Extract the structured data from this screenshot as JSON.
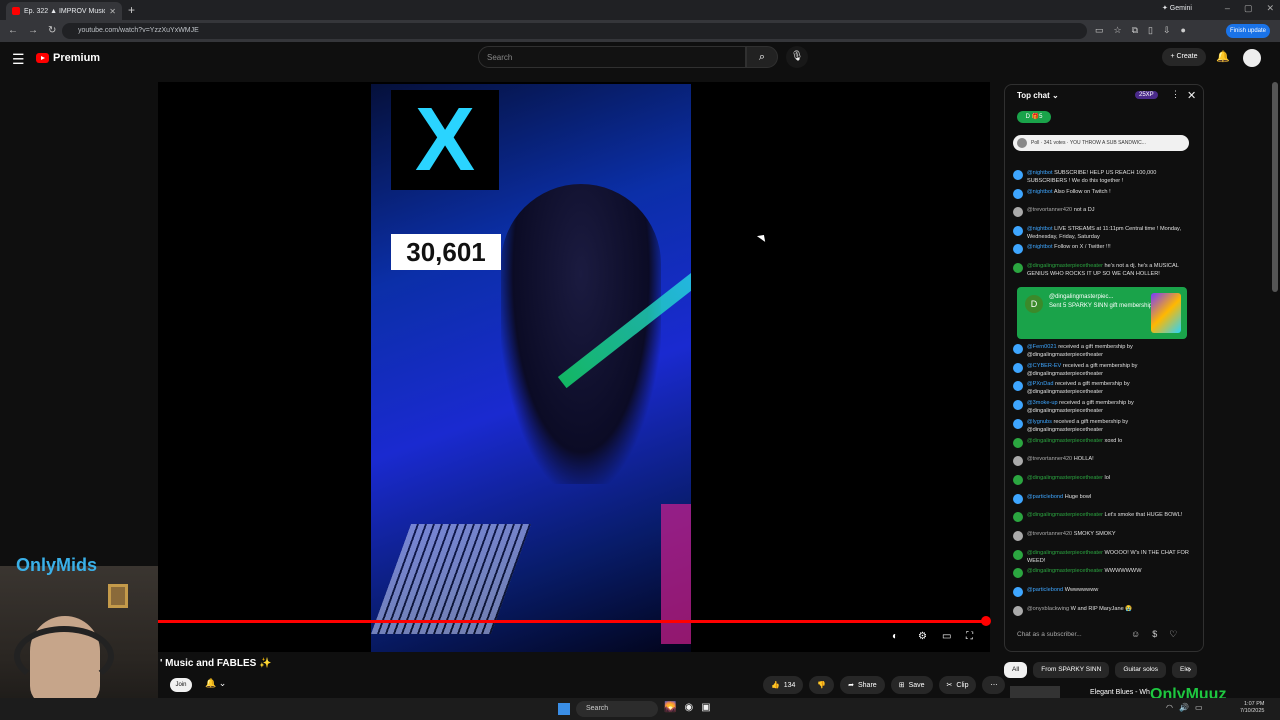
{
  "browser": {
    "tab_title": "Ep. 322 ▲ IMPROV Music",
    "tab_close": "✕",
    "new_tab": "+",
    "gemini_label": "✦ Gemini",
    "address": "youtube.com/watch?v=YzzXuYxWMJE",
    "finish_update": "Finish update",
    "nav_back": "←",
    "nav_forward": "→",
    "nav_reload": "↻"
  },
  "youtube": {
    "logo_text": "Premium",
    "search_placeholder": "Search",
    "create_label": "+ Create"
  },
  "video": {
    "sign_number": "30,601",
    "progress_fraction": 0.995,
    "title": "' Music and FABLES ✨",
    "join_label": "Join",
    "likes": "134",
    "share_label": "Share",
    "save_label": "Save",
    "clip_label": "Clip",
    "more_label": "⋯"
  },
  "webcam": {
    "overlay_logo": "OnlyMids"
  },
  "chat": {
    "header_label": "Top chat ⌄",
    "xp_badge": "25XP",
    "donor_pill": "D 🎁5",
    "poll_text": "Poll · 341 votes · YOU THROW A SUB SANDWIC...",
    "messages": [
      {
        "user": "@nightbot",
        "text": "SUBSCRIBE! HELP US REACH 100,000 SUBSCRIBERS ! We do this together !",
        "color": "#3ea6ff"
      },
      {
        "user": "@nightbot",
        "text": "Also Follow on Twitch !",
        "color": "#3ea6ff"
      },
      {
        "user": "@trevortanner420",
        "text": "not a DJ",
        "color": "#aaaaaa"
      },
      {
        "user": "@nightbot",
        "text": "LIVE STREAMS at 11:11pm Central time ! Monday, Wednesday, Friday, Saturday",
        "color": "#3ea6ff"
      },
      {
        "user": "@nightbot",
        "text": "Follow on X / Twitter !!!",
        "color": "#3ea6ff"
      },
      {
        "user": "@dingalingmasterpiecetheater",
        "text": "he's not a dj. he's a MUSICAL GENIUS WHO ROCKS IT UP SO WE CAN HOLLER!",
        "color": "#2ba640"
      }
    ],
    "gift": {
      "user": "@dingalingmasterpiec...",
      "text": "Sent 5 SPARKY SINN gift memberships",
      "initial": "D"
    },
    "messages2": [
      {
        "user": "@Fern0021",
        "text": "received a gift membership by @dingalingmasterpiecetheater",
        "color": "#3ea6ff"
      },
      {
        "user": "@CYBER-EV",
        "text": "received a gift membership by @dingalingmasterpiecetheater",
        "color": "#3ea6ff"
      },
      {
        "user": "@PXnDad",
        "text": "received a gift membership by @dingalingmasterpiecetheater",
        "color": "#3ea6ff"
      },
      {
        "user": "@3moke-up",
        "text": "received a gift membership by @dingalingmasterpiecetheater",
        "color": "#3ea6ff"
      },
      {
        "user": "@lygnubs",
        "text": "received a gift membership by @dingalingmasterpiecetheater",
        "color": "#3ea6ff"
      },
      {
        "user": "@dingalingmasterpiecetheater",
        "text": "xoxd lo",
        "color": "#2ba640"
      },
      {
        "user": "@trevortanner420",
        "text": "HOLLA!",
        "color": "#aaaaaa"
      },
      {
        "user": "@dingalingmasterpiecetheater",
        "text": "lol",
        "color": "#2ba640"
      },
      {
        "user": "@particlebond",
        "text": "Huge bowl",
        "color": "#3ea6ff"
      },
      {
        "user": "@dingalingmasterpiecetheater",
        "text": "Let's smoke that HUGE BOWL!",
        "color": "#2ba640"
      },
      {
        "user": "@trevortanner420",
        "text": "SMOKY SMOKY",
        "color": "#aaaaaa"
      },
      {
        "user": "@dingalingmasterpiecetheater",
        "text": "WOOOO! W's IN THE CHAT FOR WEED!",
        "color": "#2ba640"
      },
      {
        "user": "@dingalingmasterpiecetheater",
        "text": "WWWWWWW",
        "color": "#2ba640"
      },
      {
        "user": "@particlebond",
        "text": "Wwwwwwww",
        "color": "#3ea6ff"
      },
      {
        "user": "@onyxblackwing",
        "text": "W and RIP MaryJane 😭",
        "color": "#aaaaaa"
      }
    ],
    "input_placeholder": "Chat as a subscriber..."
  },
  "chips": [
    "All",
    "From SPARKY SINN",
    "Guitar solos",
    "Ele"
  ],
  "up_next": "Elegant Blues - Wh",
  "watermark": "OnlyMuuz",
  "taskbar": {
    "search_label": "Search",
    "clock_time": "1:07 PM",
    "clock_date": "7/10/2025"
  },
  "colors": {
    "progress": "#ff0000",
    "chat_gift": "#1aa34a",
    "accent_blue": "#1a73e8"
  }
}
